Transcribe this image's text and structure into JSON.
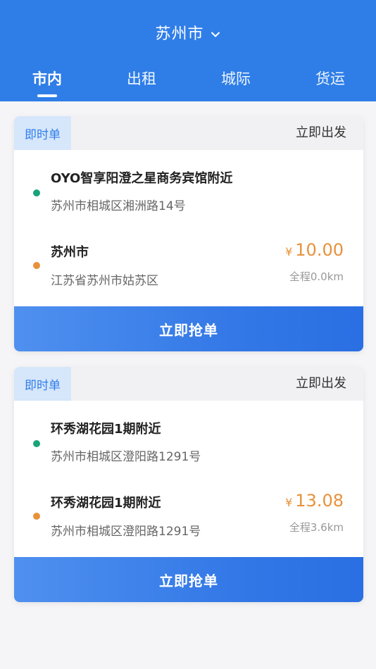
{
  "header": {
    "city": "苏州市",
    "tabs": [
      {
        "label": "市内",
        "active": true
      },
      {
        "label": "出租",
        "active": false
      },
      {
        "label": "城际",
        "active": false
      },
      {
        "label": "货运",
        "active": false
      }
    ]
  },
  "colors": {
    "primary": "#2f7ee8",
    "origin_dot": "#1aa37a",
    "dest_dot": "#e8913b",
    "price": "#e8913b"
  },
  "orders": [
    {
      "type": "即时单",
      "depart": "立即出发",
      "origin": {
        "name": "OYO智享阳澄之星商务宾馆附近",
        "address": "苏州市相城区湘洲路14号"
      },
      "destination": {
        "name": "苏州市",
        "address": "江苏省苏州市姑苏区"
      },
      "currency": "¥",
      "price": "10.00",
      "distance": "全程0.0km",
      "action": "立即抢单"
    },
    {
      "type": "即时单",
      "depart": "立即出发",
      "origin": {
        "name": "环秀湖花园1期附近",
        "address": "苏州市相城区澄阳路1291号"
      },
      "destination": {
        "name": "环秀湖花园1期附近",
        "address": "苏州市相城区澄阳路1291号"
      },
      "currency": "¥",
      "price": "13.08",
      "distance": "全程3.6km",
      "action": "立即抢单"
    }
  ]
}
